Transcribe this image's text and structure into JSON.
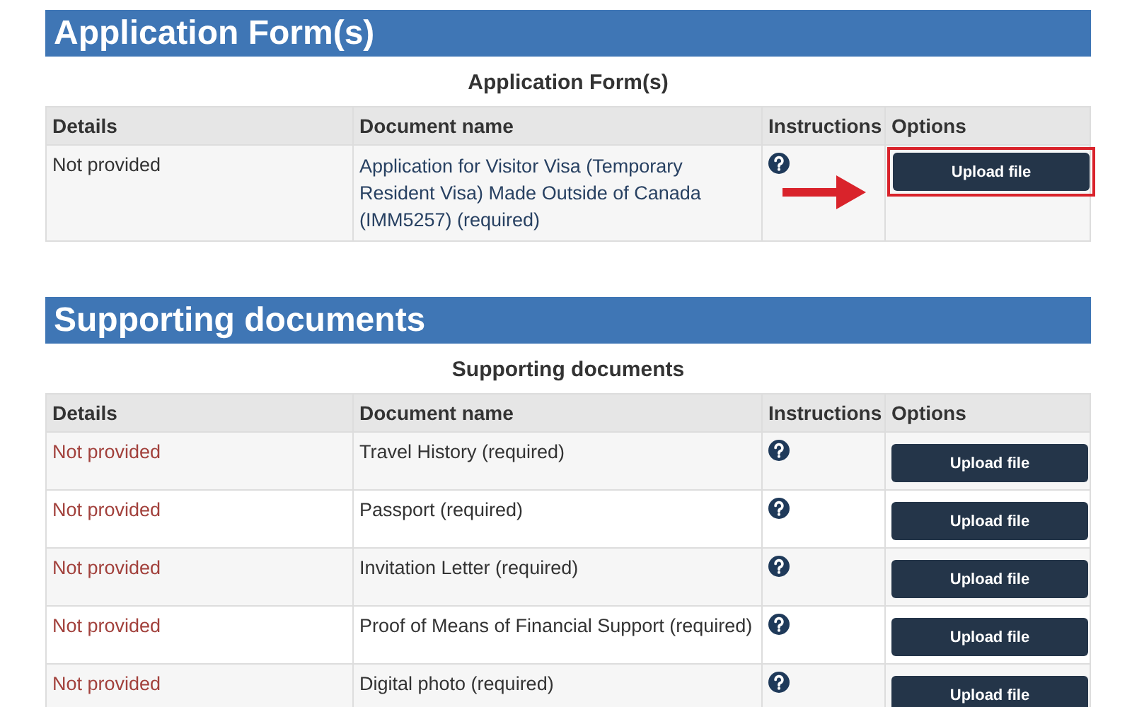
{
  "sections": [
    {
      "title": "Application Form(s)",
      "caption": "Application Form(s)",
      "columns": [
        "Details",
        "Document name",
        "Instructions",
        "Options"
      ],
      "rows": [
        {
          "details": "Not provided",
          "color": "#333333",
          "document": "Application for Visitor Visa (Temporary Resident Visa) Made Outside of Canada (IMM5257)  (required)",
          "kind": "link",
          "button": "Upload file",
          "highlighted": true
        }
      ]
    },
    {
      "title": "Supporting documents",
      "caption": "Supporting documents",
      "columns": [
        "Details",
        "Document name",
        "Instructions",
        "Options"
      ],
      "rows": [
        {
          "details": "Not provided",
          "color": "#a2413c",
          "document": "Travel History  (required)",
          "kind": "text",
          "button": "Upload file",
          "highlighted": false
        },
        {
          "details": "Not provided",
          "color": "#a2413c",
          "document": "Passport  (required)",
          "kind": "text",
          "button": "Upload file",
          "highlighted": false
        },
        {
          "details": "Not provided",
          "color": "#a2413c",
          "document": "Invitation Letter  (required)",
          "kind": "text",
          "button": "Upload file",
          "highlighted": false
        },
        {
          "details": "Not provided",
          "color": "#a2413c",
          "document": "Proof of Means of Financial Support (required)",
          "kind": "text",
          "button": "Upload file",
          "highlighted": false
        },
        {
          "details": "Not provided",
          "color": "#a2413c",
          "document": "Digital photo  (required)",
          "kind": "text",
          "button": "Upload file",
          "highlighted": false
        }
      ]
    }
  ]
}
